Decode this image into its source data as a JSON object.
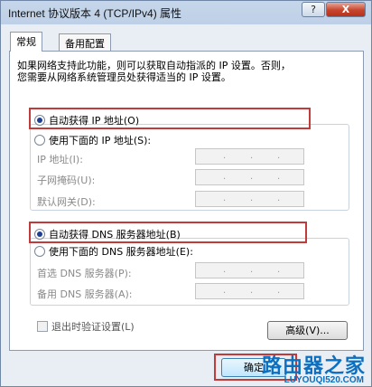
{
  "window": {
    "title": "Internet 协议版本 4 (TCP/IPv4) 属性",
    "help_label": "?",
    "close_label": "X"
  },
  "tabs": [
    {
      "label": "常规",
      "active": true
    },
    {
      "label": "备用配置",
      "active": false
    }
  ],
  "description": [
    "如果网络支持此功能，则可以获取自动指派的 IP 设置。否则，",
    "您需要从网络系统管理员处获得适当的 IP 设置。"
  ],
  "ip": {
    "auto_label": "自动获得 IP 地址(O)",
    "manual_label": "使用下面的 IP 地址(S):",
    "selected": "auto",
    "fields": [
      {
        "label": "IP 地址(I):",
        "value": ". . ."
      },
      {
        "label": "子网掩码(U):",
        "value": ". . ."
      },
      {
        "label": "默认网关(D):",
        "value": ". . ."
      }
    ]
  },
  "dns": {
    "auto_label": "自动获得 DNS 服务器地址(B)",
    "manual_label": "使用下面的 DNS 服务器地址(E):",
    "selected": "auto",
    "fields": [
      {
        "label": "首选 DNS 服务器(P):",
        "value": ". . ."
      },
      {
        "label": "备用 DNS 服务器(A):",
        "value": ". . ."
      }
    ]
  },
  "validate_label": "退出时验证设置(L)",
  "advanced_label": "高级(V)...",
  "ok_label": "确定",
  "watermark": {
    "main": "路由器之家",
    "sub": "LUYOUQI520.COM"
  },
  "colors": {
    "highlight": "#c23b3b",
    "watermark": "#0c6fbf",
    "close_button": "#c7452c"
  }
}
